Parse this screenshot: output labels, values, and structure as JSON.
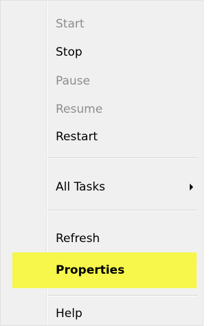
{
  "menu": {
    "items": [
      {
        "label": "Start",
        "enabled": false
      },
      {
        "label": "Stop",
        "enabled": true
      },
      {
        "label": "Pause",
        "enabled": false
      },
      {
        "label": "Resume",
        "enabled": false
      },
      {
        "label": "Restart",
        "enabled": true
      },
      {
        "label": "All Tasks",
        "enabled": true,
        "submenu": true,
        "submenu_icon": "chevron-right-icon"
      },
      {
        "label": "Refresh",
        "enabled": true
      },
      {
        "label": "Properties",
        "enabled": true,
        "highlighted": true,
        "highlight_color": "#f6f74a"
      },
      {
        "label": "Help",
        "enabled": true
      }
    ]
  }
}
